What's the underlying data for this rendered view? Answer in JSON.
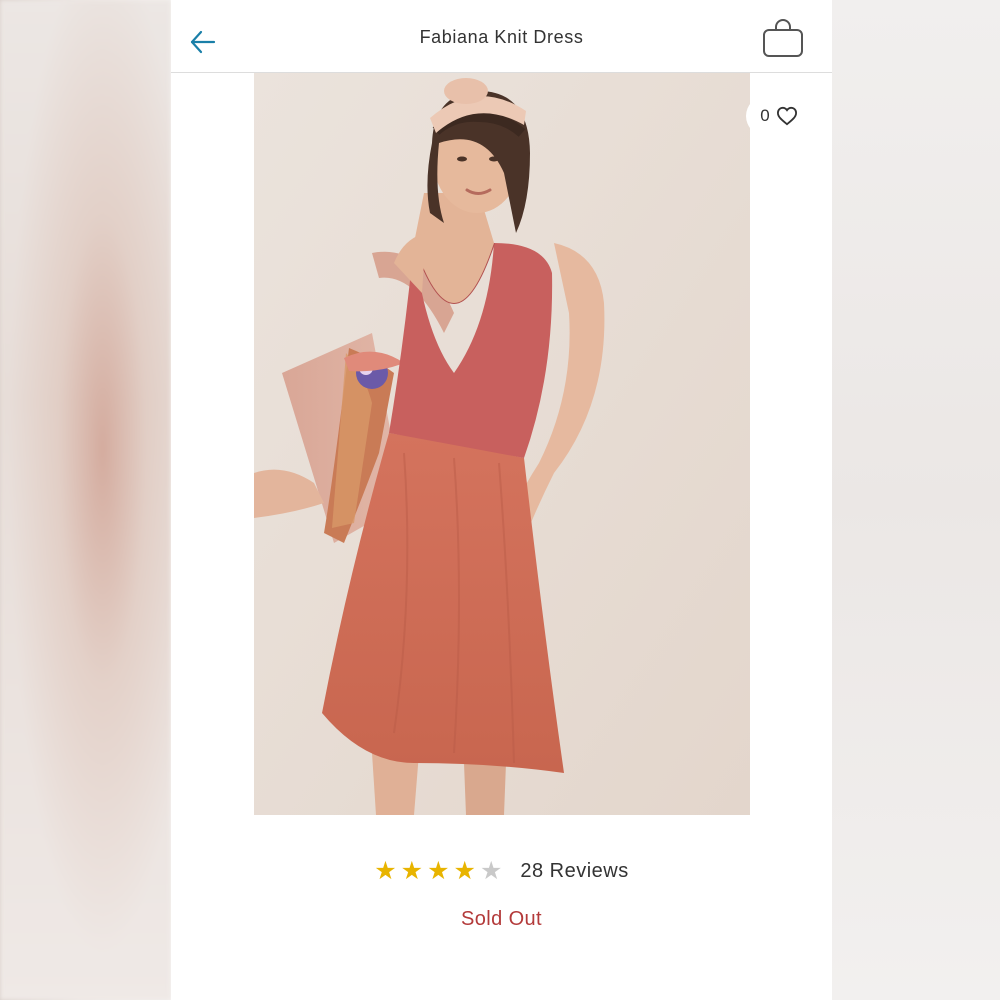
{
  "header": {
    "title": "Fabiana Knit Dress",
    "back_icon": "arrow-left-icon",
    "bag_icon": "shopping-bag-icon"
  },
  "product": {
    "image_alt": "Fabiana Knit Dress",
    "favorites_count": "0",
    "favorite_icon": "heart-outline-icon",
    "rating_value": 4,
    "rating_max": 5,
    "reviews_label": "28 Reviews",
    "status_text": "Sold Out"
  },
  "colors": {
    "accent": "#1a7fa8",
    "star_filled": "#e8b400",
    "star_empty": "#c9c9c9",
    "sold_out": "#b33a3a"
  }
}
